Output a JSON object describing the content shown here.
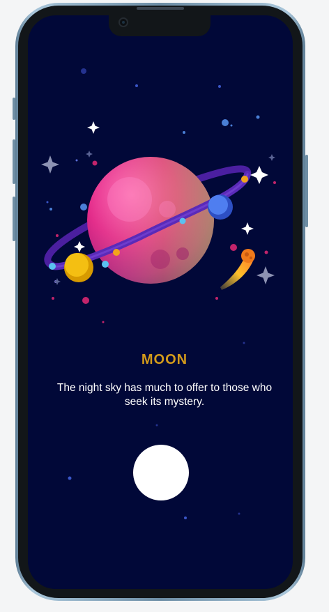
{
  "screen": {
    "title": "MOON",
    "description": "The night sky has much to offer to those who seek its mystery."
  },
  "colors": {
    "screen_background": "#010838",
    "title": "#d39b1a",
    "text": "#ffffff",
    "button": "#ffffff",
    "device_frame": "#121619"
  },
  "icons": [
    "planet-illustration",
    "sparkle-icon",
    "comet-icon"
  ]
}
